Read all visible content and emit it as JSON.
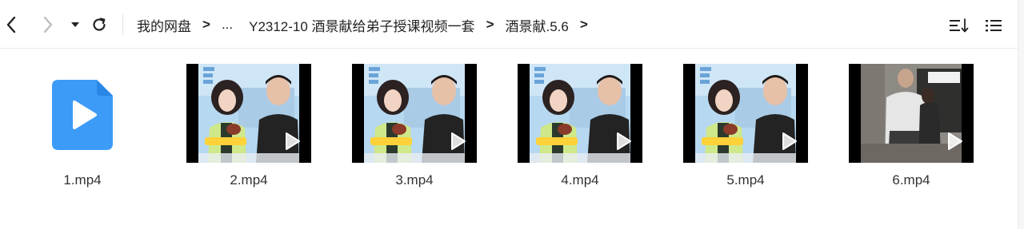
{
  "toolbar": {
    "back_icon": "chevron-left-icon",
    "forward_icon": "chevron-right-icon",
    "history_icon": "caret-down-icon",
    "refresh_icon": "refresh-icon",
    "sort_icon": "sort-icon",
    "list_view_icon": "list-view-icon"
  },
  "breadcrumb": {
    "root": "我的网盘",
    "sep": ">",
    "ellipsis": "...",
    "folder": "Y2312-10 酒景献给弟子授课视频一套",
    "current": "酒景献.5.6"
  },
  "files": [
    {
      "name": "1.mp4",
      "kind": "generic-video-icon"
    },
    {
      "name": "2.mp4",
      "kind": "video-thumbnail"
    },
    {
      "name": "3.mp4",
      "kind": "video-thumbnail"
    },
    {
      "name": "4.mp4",
      "kind": "video-thumbnail"
    },
    {
      "name": "5.mp4",
      "kind": "video-thumbnail"
    },
    {
      "name": "6.mp4",
      "kind": "video-thumbnail"
    }
  ],
  "colors": {
    "file_icon_blue": "#3d9bf8",
    "text": "#222222",
    "divider": "#ececec"
  }
}
